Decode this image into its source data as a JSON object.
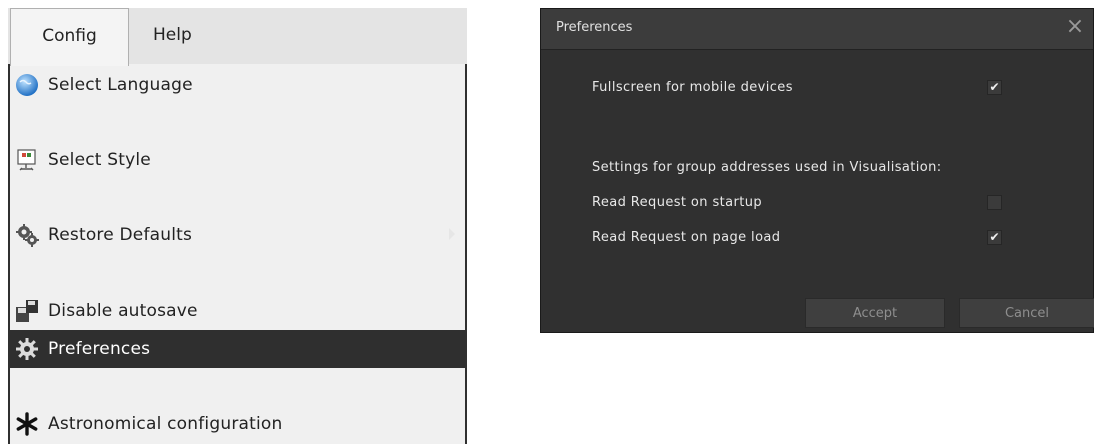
{
  "menubar": {
    "tabs": [
      {
        "label": "Config",
        "active": true
      },
      {
        "label": "Help",
        "active": false
      }
    ]
  },
  "menu": {
    "items": [
      {
        "label": "Select Language",
        "icon": "globe-icon"
      },
      {
        "label": "Select Style",
        "icon": "monitor-icon"
      },
      {
        "label": "Restore Defaults",
        "icon": "gears-icon"
      },
      {
        "label": "Disable autosave",
        "icon": "save-icon"
      },
      {
        "label": "Preferences",
        "icon": "gear-icon",
        "selected": true
      },
      {
        "label": "Astronomical configuration",
        "icon": "asterisk-icon"
      }
    ]
  },
  "dialog": {
    "title": "Preferences",
    "close_glyph": "×",
    "options": [
      {
        "label": "Fullscreen for mobile devices",
        "checked": true
      },
      {
        "label": "Settings for group addresses used in Visualisation:",
        "is_heading": true
      },
      {
        "label": "Read Request on startup",
        "checked": false
      },
      {
        "label": "Read Request on page load",
        "checked": true
      }
    ],
    "buttons": {
      "accept": "Accept",
      "cancel": "Cancel"
    },
    "check_glyph": "✔"
  },
  "colors": {
    "dialog_bg": "#303030",
    "menu_selected_bg": "#2f2f2f",
    "menu_bg": "#f0f0f0"
  }
}
